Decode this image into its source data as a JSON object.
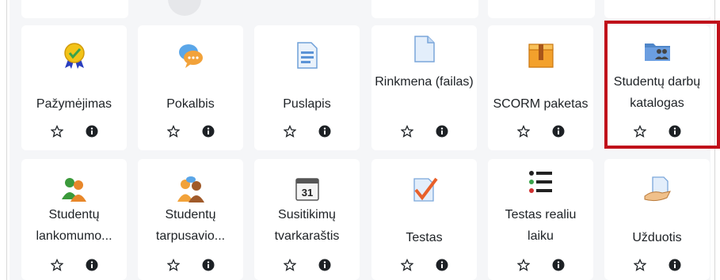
{
  "activities_row1": [
    {
      "label": "Pažymėjimas",
      "icon": "certificate-icon"
    },
    {
      "label": "Pokalbis",
      "icon": "chat-icon"
    },
    {
      "label": "Puslapis",
      "icon": "page-icon"
    },
    {
      "label": "Rinkmena (failas)",
      "icon": "file-icon"
    },
    {
      "label": "SCORM paketas",
      "icon": "scorm-package-icon"
    },
    {
      "label": "Studentų darbų katalogas",
      "icon": "folder-users-icon"
    }
  ],
  "activities_row2": [
    {
      "label": "Studentų lankomumo...",
      "icon": "attendance-icon"
    },
    {
      "label": "Studentų tarpusavio...",
      "icon": "peer-review-icon"
    },
    {
      "label": "Susitikimų tvarkaraštis",
      "icon": "calendar-icon"
    },
    {
      "label": "Testas",
      "icon": "quiz-icon"
    },
    {
      "label": "Testas realiu laiku",
      "icon": "realtime-quiz-icon"
    },
    {
      "label": "Užduotis",
      "icon": "assignment-icon"
    }
  ],
  "calendar_day": "31",
  "action_icons": [
    "star-icon",
    "info-icon"
  ],
  "colors": {
    "highlight": "#c0101a",
    "text": "#1d2125",
    "icon": "#1d2125"
  }
}
